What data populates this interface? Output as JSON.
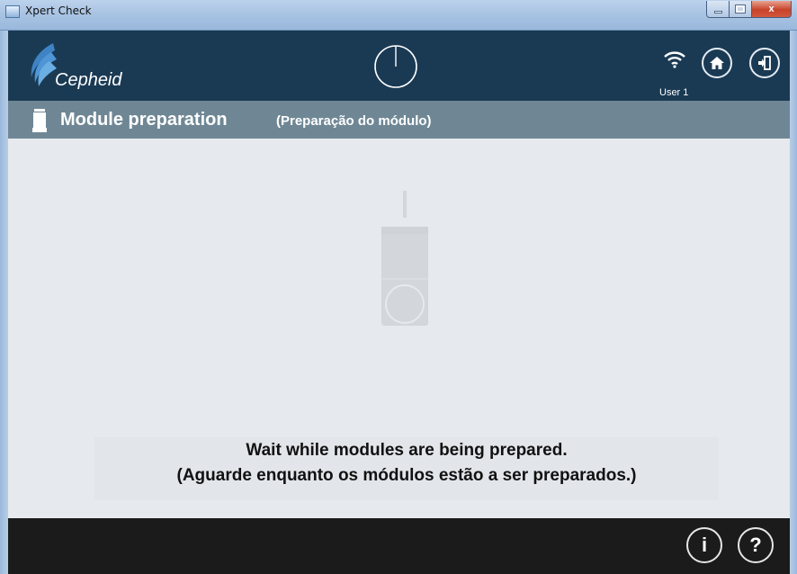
{
  "window": {
    "title": "Xpert Check",
    "close_label": "x"
  },
  "header": {
    "brand": "Cepheid",
    "user_label": "User 1"
  },
  "subheader": {
    "title": "Module preparation",
    "title_translation": "(Preparação do módulo)"
  },
  "main": {
    "message_line1": "Wait while modules are being prepared.",
    "message_line2": "(Aguarde enquanto os módulos estão a ser preparados.)"
  },
  "footer": {
    "info_label": "i",
    "help_label": "?"
  },
  "icons": {
    "app": "app-icon",
    "logo": "cepheid-logo",
    "timer": "timer-icon",
    "wifi": "wifi-icon",
    "home": "home-icon",
    "exit": "exit-icon",
    "cartridge": "cartridge-icon"
  },
  "colors": {
    "header_bg": "#1a3a54",
    "subheader_bg": "#6f8795",
    "content_bg": "#e6e9ed",
    "footer_bg": "#1b1b1b"
  }
}
